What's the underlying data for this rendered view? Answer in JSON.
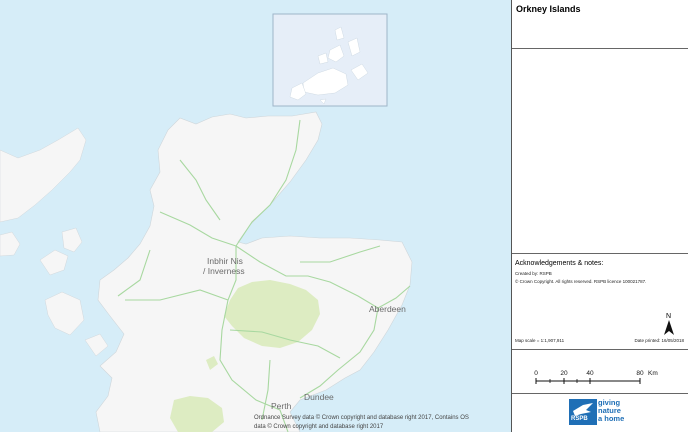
{
  "map": {
    "places": [
      "Inbhir Nis",
      "/ Inverness",
      "Aberdeen",
      "Dundee",
      "Perth"
    ],
    "attribution": [
      "Ordnance Survey data © Crown copyright and database right 2017, Contains OS",
      "data © Crown copyright and database right 2017"
    ],
    "colors": {
      "sea": "#d9eef8",
      "land": "#f6f6f6",
      "uplands": "#ddecc2",
      "roads": "#a8d8a0",
      "inset": "#e4eef8"
    }
  },
  "panel": {
    "title": "Orkney Islands",
    "ack_heading": "Acknowledgements & notes:",
    "created_by": "Created by:  RSPB",
    "copyright": "© Crown Copyright. All rights reserved. RSPB licence 100021787.",
    "map_scale": "Map scale = 1:1,907,911",
    "date_printed": "Date printed: 16/05/2018",
    "north": "N",
    "scale_ticks": [
      "0",
      "20",
      "40",
      "80"
    ],
    "scale_unit": "Km",
    "logo_lines": [
      "giving",
      "nature",
      "a home"
    ],
    "logo_rspb": "RSPB"
  }
}
